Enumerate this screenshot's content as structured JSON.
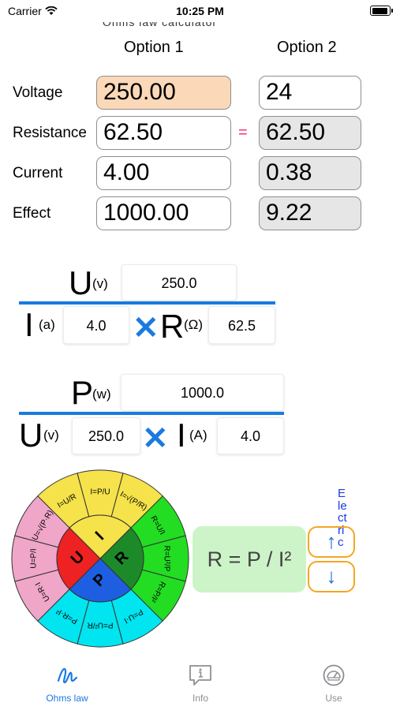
{
  "status_bar": {
    "carrier": "Carrier",
    "time": "10:25 PM"
  },
  "header": {
    "cut_title": "Ohms law calculator"
  },
  "options": {
    "option1_header": "Option 1",
    "option2_header": "Option 2",
    "equals_sign": "=",
    "rows": [
      {
        "label": "Voltage",
        "opt1": "250.00",
        "opt2": "24"
      },
      {
        "label": "Resistance",
        "opt1": "62.50",
        "opt2": "62.50"
      },
      {
        "label": "Current",
        "opt1": "4.00",
        "opt2": "0.38"
      },
      {
        "label": "Effect",
        "opt1": "1000.00",
        "opt2": "9.22"
      }
    ]
  },
  "formula_u": {
    "u_letter": "U",
    "u_unit": "(v)",
    "u_value": "250.0",
    "i_letter": "I",
    "i_unit": "(a)",
    "i_value": "4.0",
    "times": "✕",
    "r_letter": "R",
    "r_unit": "(Ω)",
    "r_value": "62.5"
  },
  "formula_p": {
    "p_letter": "P",
    "p_unit": "(w)",
    "p_value": "1000.0",
    "u_letter": "U",
    "u_unit": "(v)",
    "u_value": "250.0",
    "times": "✕",
    "i_letter": "I",
    "i_unit": "(A)",
    "i_value": "4.0"
  },
  "wheel": {
    "center": [
      "U",
      "I",
      "R",
      "P"
    ],
    "outer_formulas": [
      "I=U/R",
      "I=P/U",
      "I=√(P/R)",
      "R=U/I",
      "R=U²/P",
      "R=P/I²",
      "P=U·I",
      "P=U²/R",
      "P=R·I²",
      "U=R·I",
      "U=P/I",
      "U=√(P·R)"
    ],
    "colors": {
      "I": "#f6e24a",
      "R": "#22cc22",
      "P": "#1e90ff",
      "U": "#ee2222"
    }
  },
  "result": {
    "text": "R = P / I²"
  },
  "controls": {
    "up": "↑",
    "down": "↓",
    "vertical_text": "Electric"
  },
  "tabs": [
    {
      "label": "Ohms law",
      "icon": "scribble-icon",
      "active": true
    },
    {
      "label": "Info",
      "icon": "info-bubble-icon",
      "active": false
    },
    {
      "label": "Use",
      "icon": "gauge-icon",
      "active": false
    }
  ],
  "colors": {
    "accent": "#1a7ae0",
    "selected_field": "#fbd9b8",
    "readonly_field": "#e6e6e6",
    "result_bg": "#cdf4c8"
  }
}
